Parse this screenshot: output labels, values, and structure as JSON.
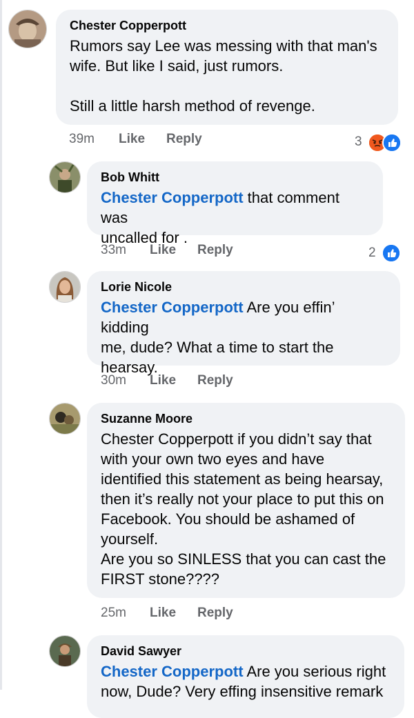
{
  "comments": [
    {
      "author": "Chester Copperpott",
      "mention": "",
      "text": "Rumors say Lee was messing with that man's\nwife. But like I said, just rumors.\n\nStill a little harsh method of revenge.",
      "time": "39m",
      "like_label": "Like",
      "reply_label": "Reply",
      "reaction_count": "3",
      "reactions": [
        "angry-icon",
        "like-icon"
      ]
    },
    {
      "author": "Bob Whitt",
      "mention": "Chester Copperpott",
      "text": " that comment was\nuncalled for .",
      "time": "33m",
      "like_label": "Like",
      "reply_label": "Reply",
      "reaction_count": "2",
      "reactions": [
        "like-icon"
      ]
    },
    {
      "author": "Lorie Nicole",
      "mention": "Chester Copperpott",
      "text": " Are you effin’ kidding\nme, dude? What a time to start the\nhearsay.",
      "time": "30m",
      "like_label": "Like",
      "reply_label": "Reply",
      "reaction_count": "",
      "reactions": []
    },
    {
      "author": "Suzanne Moore",
      "mention": "",
      "text": "Chester Copperpott if you didn’t say that\nwith your own two eyes and have\nidentified this statement as being hearsay,\nthen it’s really not your place to put this on\nFacebook. You should be ashamed of\nyourself.\nAre you so SINLESS that you can cast the\nFIRST stone????",
      "time": "25m",
      "like_label": "Like",
      "reply_label": "Reply",
      "reaction_count": "",
      "reactions": []
    },
    {
      "author": "David Sawyer",
      "mention": "Chester Copperpott",
      "text": " Are you serious right\nnow, Dude? Very effing insensitive remark",
      "time": "",
      "like_label": "",
      "reply_label": "",
      "reaction_count": "",
      "reactions": []
    }
  ],
  "colors": {
    "bubble": "#f0f2f5",
    "mention": "#1467c7",
    "meta": "#65676b",
    "like_blue": "#1877f2",
    "angry_red": "#e9710f"
  }
}
